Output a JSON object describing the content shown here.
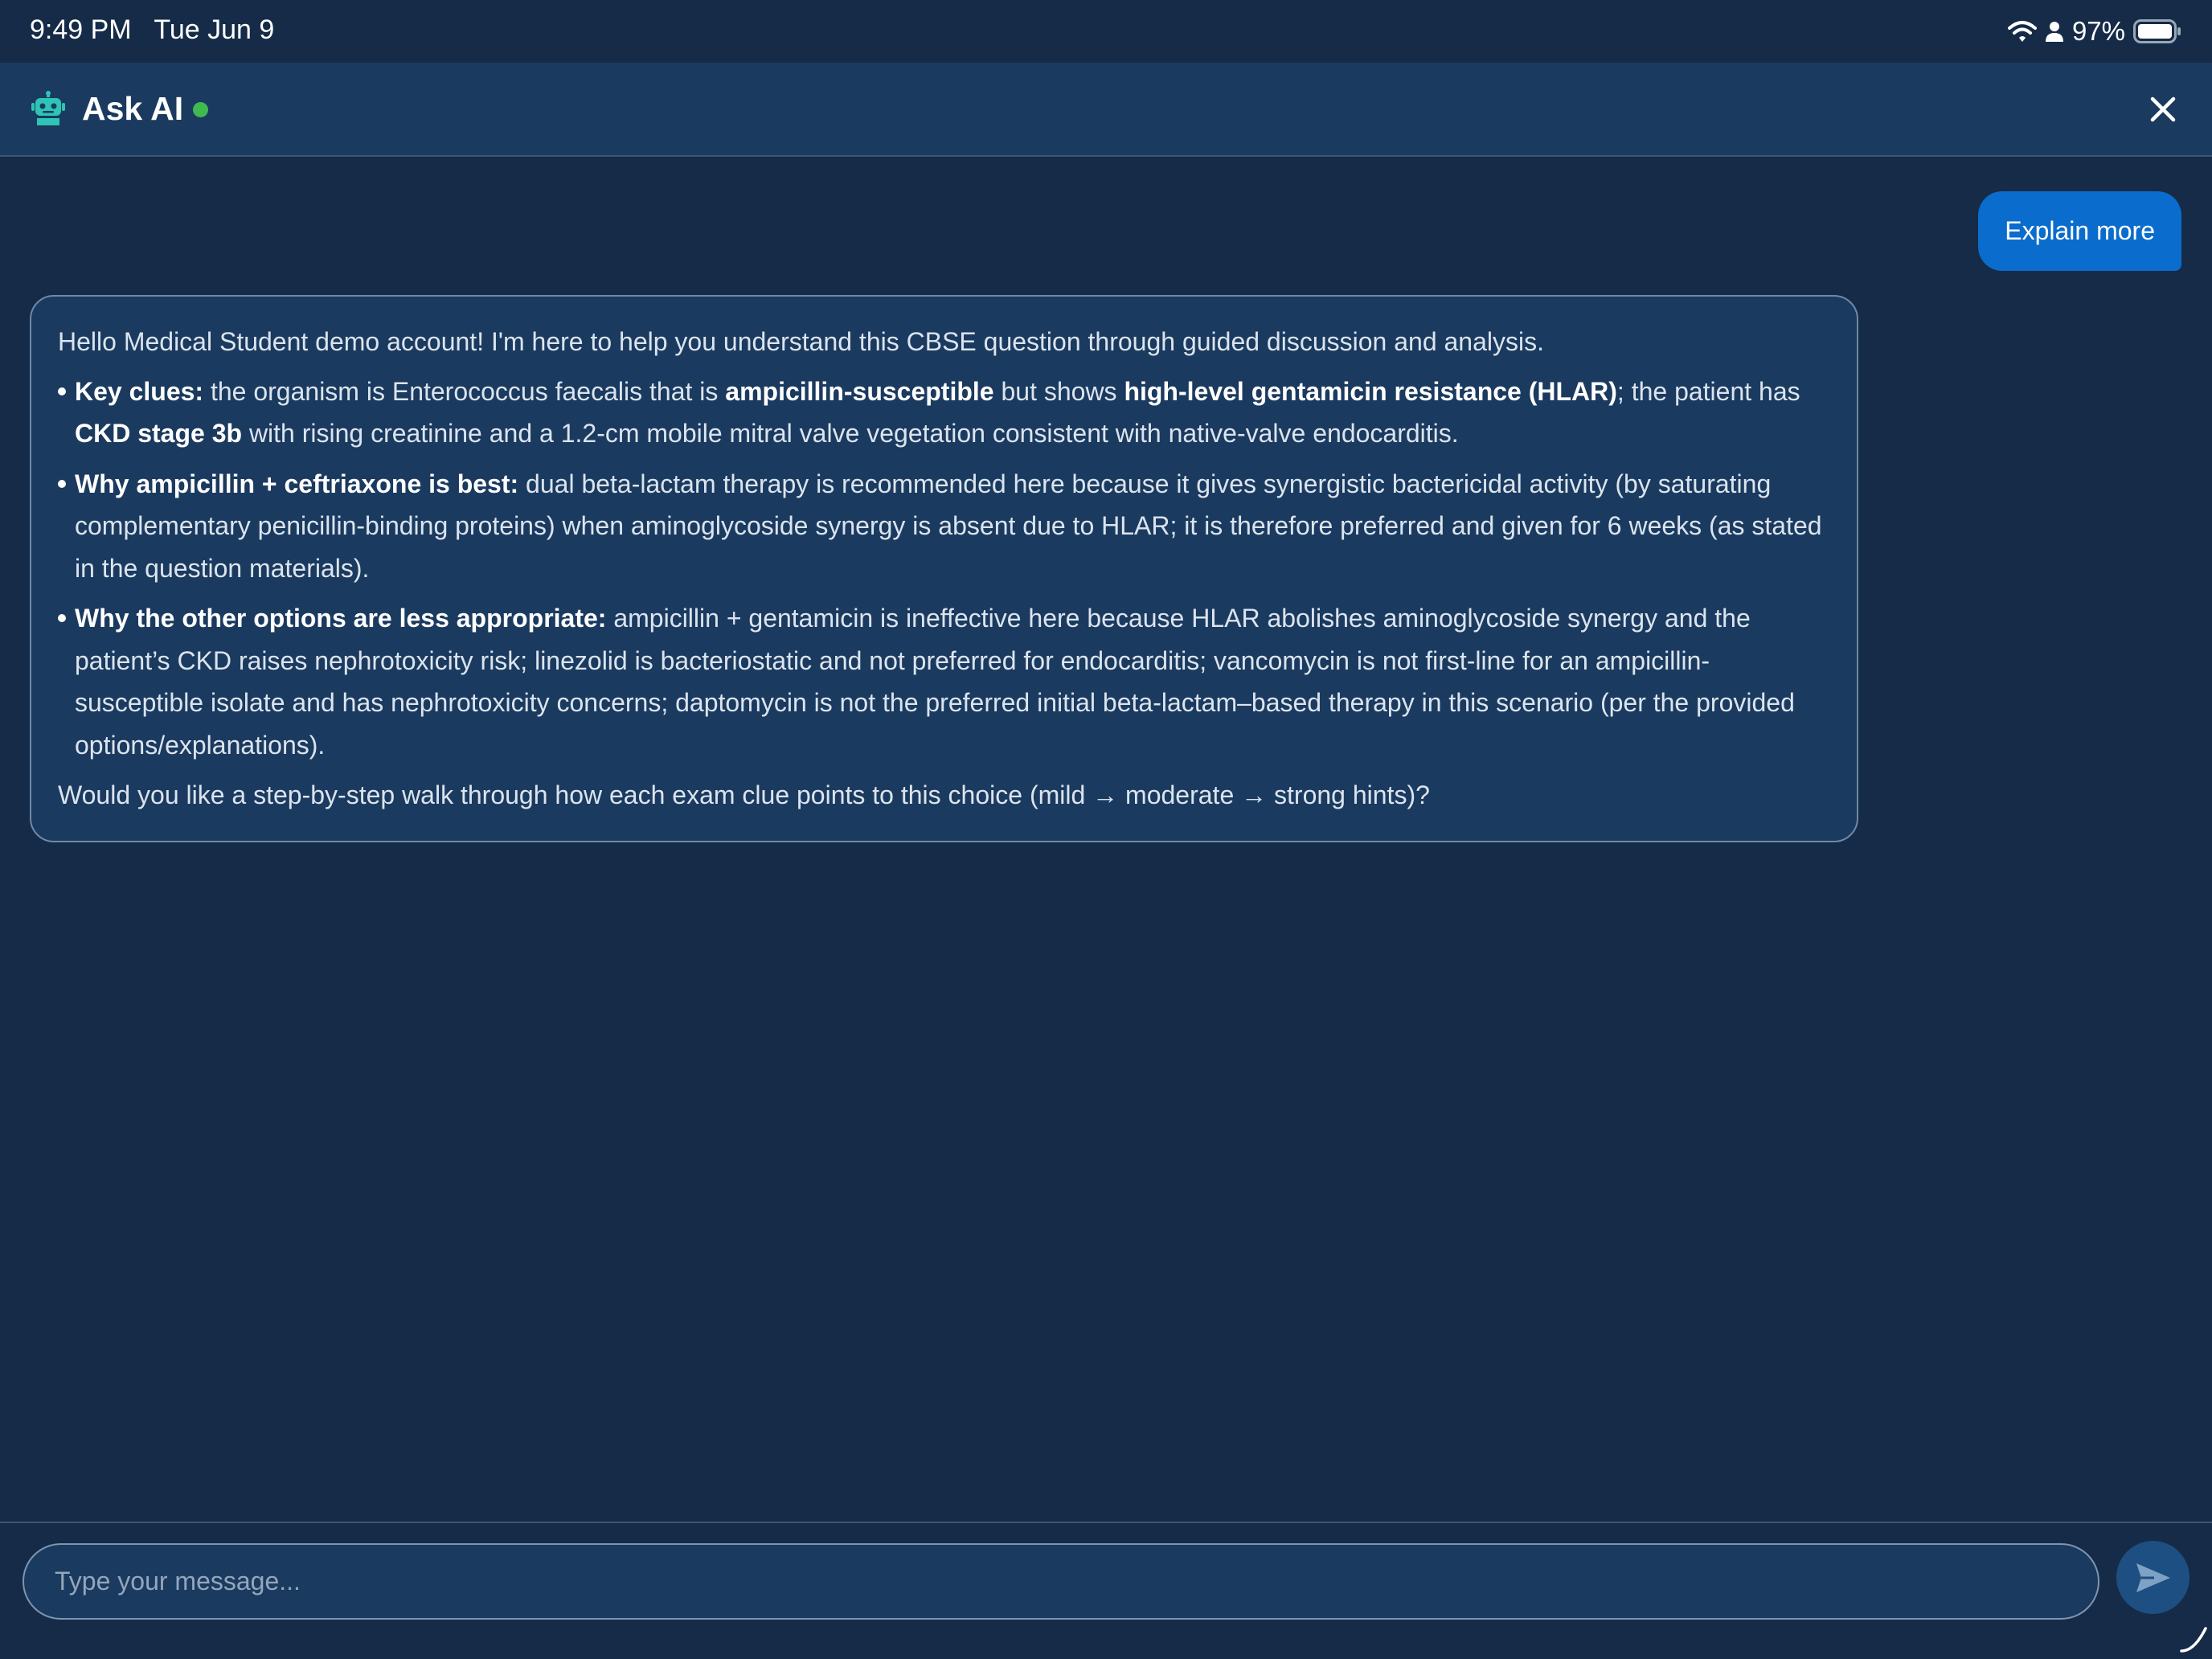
{
  "status_bar": {
    "time": "9:49 PM   Tue Jun 9",
    "battery_percent": "97%",
    "icons": [
      "wifi-icon",
      "person-icon",
      "battery-icon"
    ]
  },
  "header": {
    "title": "Ask AI",
    "icon": "robot-icon",
    "status": "online",
    "status_color": "#3fb950",
    "close_icon": "close-icon"
  },
  "messages": {
    "user": {
      "text": "Explain more"
    },
    "assistant": {
      "intro": "Hello Medical Student demo account! I'm here to help you understand this CBSE question through guided discussion and analysis.",
      "bullet1": {
        "label": "Key clues:",
        "t1": " the organism is Enterococcus faecalis that is ",
        "b1": "ampicillin-susceptible",
        "t2": " but shows ",
        "b2": "high-level gentamicin resistance (HLAR)",
        "t3": "; the patient has ",
        "b3": "CKD stage 3b",
        "t4": " with rising creatinine and a 1.2-cm mobile mitral valve vegetation consistent with native-valve endocarditis."
      },
      "bullet2": {
        "label": "Why ampicillin + ceftriaxone is best:",
        "text": " dual beta-lactam therapy is recommended here because it gives synergistic bactericidal activity (by saturating complementary penicillin-binding proteins) when aminoglycoside synergy is absent due to HLAR; it is therefore preferred and given for 6 weeks (as stated in the question materials)."
      },
      "bullet3": {
        "label": "Why the other options are less appropriate:",
        "text": " ampicillin + gentamicin is ineffective here because HLAR abolishes aminoglycoside synergy and the patient’s CKD raises nephrotoxicity risk; linezolid is bacteriostatic and not preferred for endocarditis; vancomycin is not first-line for an ampicillin-susceptible isolate and has nephrotoxicity concerns; daptomycin is not the preferred initial beta-lactam–based therapy in this scenario (per the provided options/explanations)."
      },
      "outro": "Would you like a step-by-step walk through how each exam clue points to this choice (mild → moderate → strong hints)?"
    }
  },
  "composer": {
    "placeholder": "Type your message...",
    "value": "",
    "send_icon": "send-icon"
  },
  "colors": {
    "background": "#152b47",
    "panel": "#1b3a5f",
    "user_bubble": "#0a6ccc",
    "accent_teal": "#2ec4b6"
  }
}
